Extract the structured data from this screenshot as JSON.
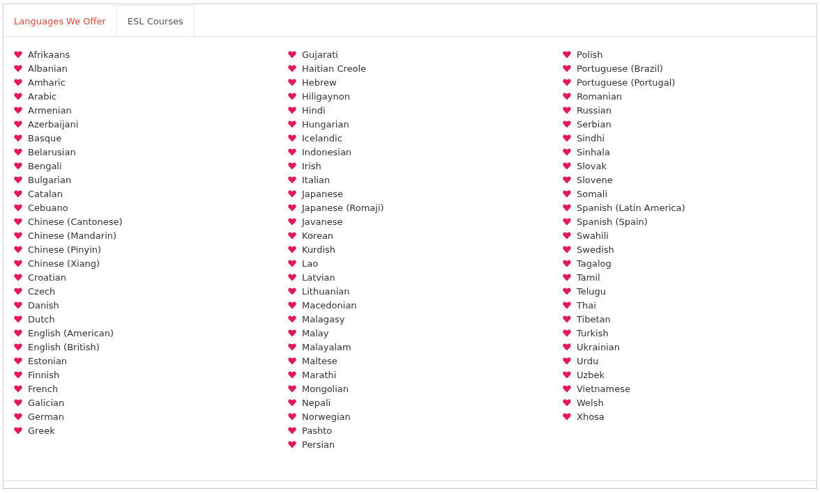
{
  "tabs": [
    {
      "label": "Languages We Offer",
      "selected": true
    },
    {
      "label": "ESL Courses",
      "selected": false
    }
  ],
  "columns": [
    {
      "items": [
        "Afrikaans",
        "Albanian",
        "Amharic",
        "Arabic",
        "Armenian",
        "Azerbaijani",
        "Basque",
        "Belarusian",
        "Bengali",
        "Bulgarian",
        "Catalan",
        "Cebuano",
        "Chinese (Cantonese)",
        "Chinese (Mandarin)",
        "Chinese (Pinyin)",
        "Chinese (Xiang)",
        "Croatian",
        "Czech",
        "Danish",
        "Dutch",
        "English (American)",
        "English (British)",
        "Estonian",
        "Finnish",
        "French",
        "Galician",
        "German",
        "Greek"
      ]
    },
    {
      "items": [
        "Gujarati",
        "Haitian Creole",
        "Hebrew",
        "Hiligaynon",
        "Hindi",
        "Hungarian",
        "Icelandic",
        "Indonesian",
        "Irish",
        "Italian",
        "Japanese",
        "Japanese (Romaji)",
        "Javanese",
        "Korean",
        "Kurdish",
        "Lao",
        "Latvian",
        "Lithuanian",
        "Macedonian",
        "Malagasy",
        "Malay",
        "Malayalam",
        "Maltese",
        "Marathi",
        "Mongolian",
        "Nepali",
        "Norwegian",
        "Pashto",
        "Persian"
      ]
    },
    {
      "items": [
        "Polish",
        "Portuguese (Brazil)",
        "Portuguese (Portugal)",
        "Romanian",
        "Russian",
        "Serbian",
        "Sindhi",
        "Sinhala",
        "Slovak",
        "Slovene",
        "Somali",
        "Spanish (Latin America)",
        "Spanish (Spain)",
        "Swahili",
        "Swedish",
        "Tagalog",
        "Tamil",
        "Telugu",
        "Thai",
        "Tibetan",
        "Turkish",
        "Ukrainian",
        "Urdu",
        "Uzbek",
        "Vietnamese",
        "Welsh",
        "Xhosa"
      ]
    }
  ]
}
